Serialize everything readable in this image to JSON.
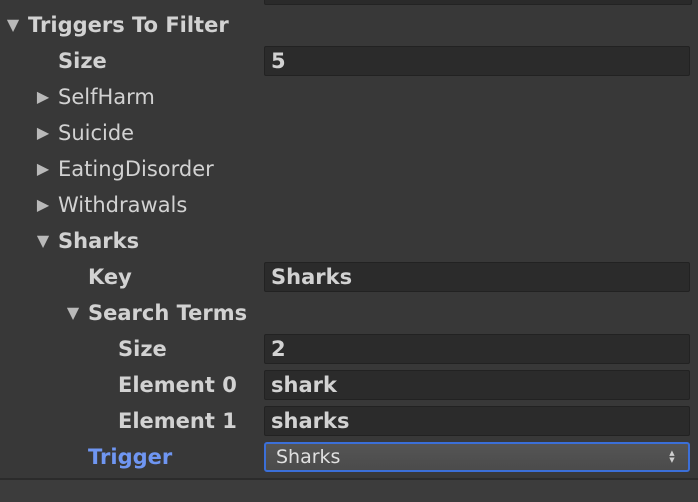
{
  "inspector": {
    "root": {
      "label": "Triggers To Filter",
      "expanded": true
    },
    "size": {
      "label": "Size",
      "value": "5"
    },
    "collapsed_items": [
      {
        "label": "SelfHarm"
      },
      {
        "label": "Suicide"
      },
      {
        "label": "EatingDisorder"
      },
      {
        "label": "Withdrawals"
      }
    ],
    "sharks": {
      "label": "Sharks",
      "expanded": true,
      "key": {
        "label": "Key",
        "value": "Sharks"
      },
      "search_terms": {
        "label": "Search Terms",
        "expanded": true,
        "size": {
          "label": "Size",
          "value": "2"
        },
        "elements": [
          {
            "label": "Element 0",
            "value": "shark"
          },
          {
            "label": "Element 1",
            "value": "sharks"
          }
        ]
      },
      "trigger": {
        "label": "Trigger",
        "selected": "Sharks"
      }
    }
  },
  "icons": {
    "expanded": "triangle-down-icon",
    "collapsed": "triangle-right-icon",
    "dropdown": "dropdown-arrows-icon"
  },
  "colors": {
    "background": "#383838",
    "field_bg": "#2b2b2b",
    "accent": "#6f96f2",
    "focus_border": "#3b6fd8"
  }
}
